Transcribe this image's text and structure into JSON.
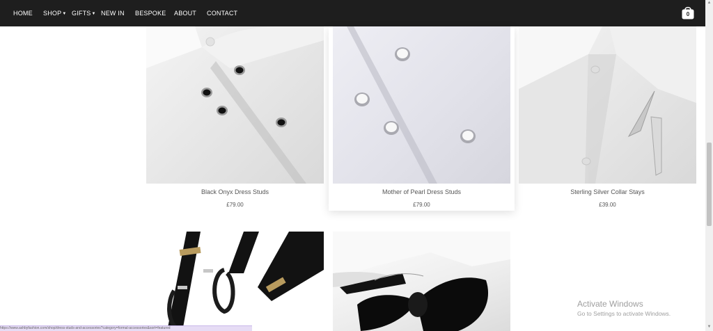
{
  "nav": {
    "items": [
      {
        "label": "HOME"
      },
      {
        "label": "SHOP"
      },
      {
        "label": "GIFTS"
      },
      {
        "label": "NEW IN"
      },
      {
        "label": "BESPOKE"
      },
      {
        "label": "ABOUT"
      },
      {
        "label": "CONTACT"
      }
    ],
    "cart_count": "0"
  },
  "products": [
    {
      "name": "Black Onyx Dress Studs",
      "price": "£79.00"
    },
    {
      "name": "Mother of Pearl Dress Studs",
      "price": "£79.00"
    },
    {
      "name": "Sterling Silver Collar Stays",
      "price": "£39.00"
    },
    {
      "name": "",
      "price": ""
    },
    {
      "name": "",
      "price": ""
    }
  ],
  "windows_watermark": {
    "title": "Activate Windows",
    "subtitle": "Go to Settings to activate Windows."
  },
  "status_bar": {
    "text": "https://www.ashbyfashion.com/shop/dress-studs-and-accessories?category=formal-accessories&sort=featured"
  },
  "colors": {
    "nav_bg": "#1e1e1e",
    "nav_text": "#ffffff",
    "text": "#555555"
  }
}
